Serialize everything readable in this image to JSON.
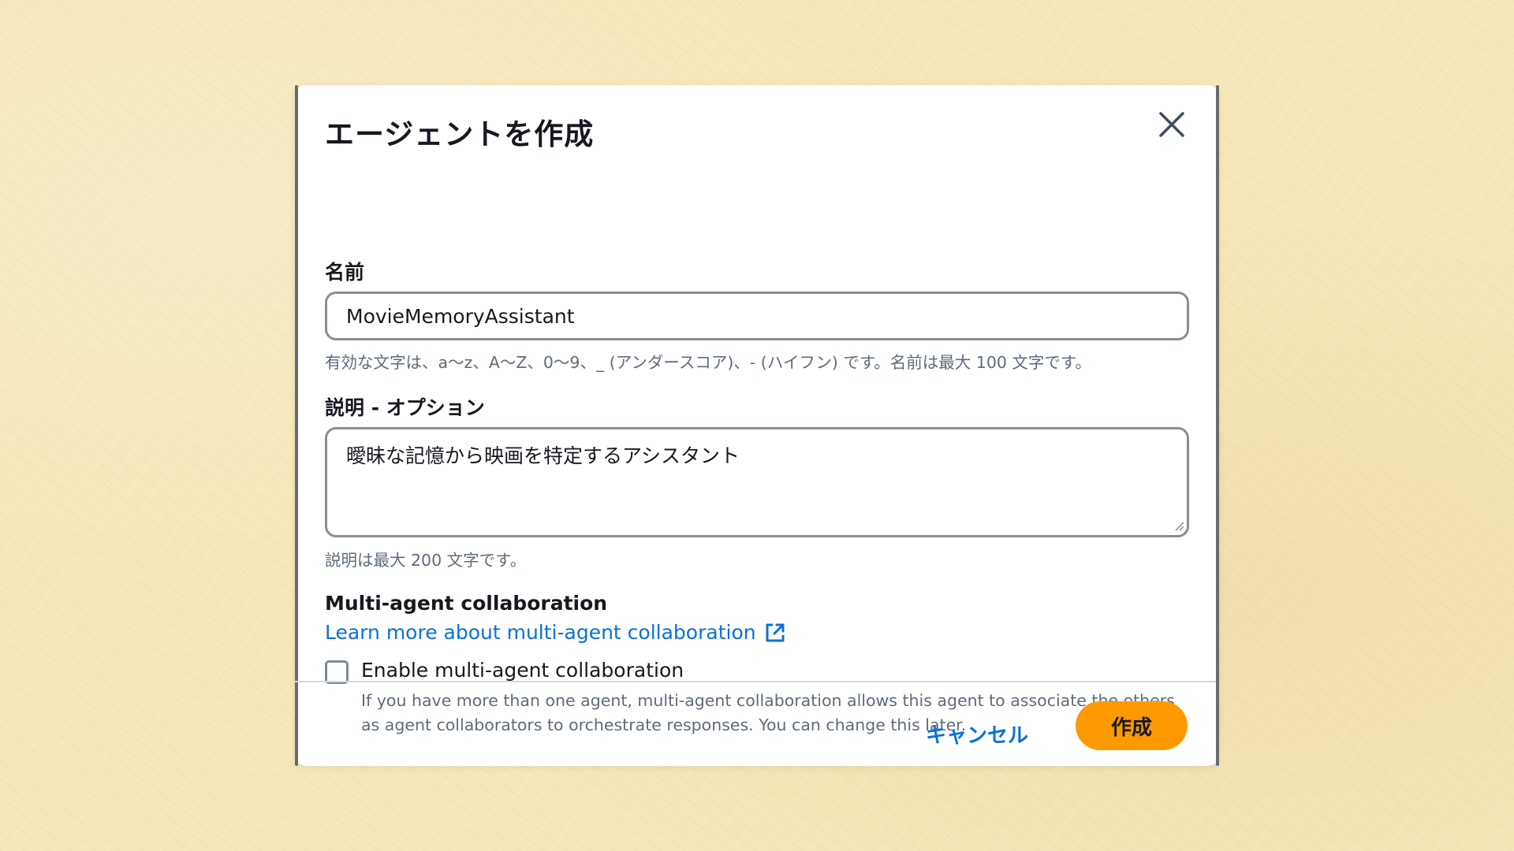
{
  "dialog": {
    "title": "エージェントを作成",
    "close_icon": "close-icon"
  },
  "name_field": {
    "label": "名前",
    "value": "MovieMemoryAssistant",
    "hint": "有効な文字は、a〜z、A〜Z、0〜9、_ (アンダースコア)、- (ハイフン) です。名前は最大 100 文字です。"
  },
  "description_field": {
    "label": "説明 - オプション",
    "value": "曖昧な記憶から映画を特定するアシスタント",
    "hint": "説明は最大 200 文字です。"
  },
  "multi_agent": {
    "title": "Multi-agent collaboration",
    "link_text": "Learn more about multi-agent collaboration",
    "link_icon": "external-link-icon",
    "checkbox_label": "Enable multi-agent collaboration",
    "checkbox_checked": false,
    "checkbox_description": "If you have more than one agent, multi-agent collaboration allows this agent to associate the others as agent collaborators to orchestrate responses. You can change this later."
  },
  "footer": {
    "cancel_label": "キャンセル",
    "create_label": "作成"
  },
  "colors": {
    "background": "#f5e7b8",
    "link": "#0972d3",
    "primary_button": "#ff9900",
    "text": "#16191f",
    "hint_text": "#5f6b7a"
  }
}
